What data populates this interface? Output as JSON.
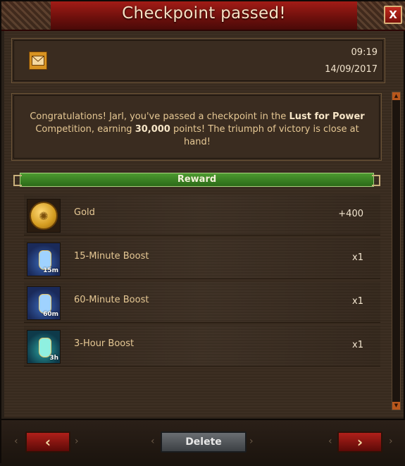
{
  "window": {
    "title": "Checkpoint passed!",
    "close_label": "X"
  },
  "message": {
    "time": "09:19",
    "date": "14/09/2017",
    "text_before": "Congratulations! Jarl, you've passed a checkpoint in the ",
    "competition": "Lust for Power",
    "text_mid": " Competition, earning ",
    "points": "30,000",
    "text_after": " points! The triumph of victory is close at hand!"
  },
  "reward": {
    "header": "Reward",
    "items": [
      {
        "name": "Gold",
        "qty": "+400",
        "icon": "gold-coin-icon"
      },
      {
        "name": "15-Minute Boost",
        "qty": "x1",
        "icon": "boost-potion-icon",
        "badge": "15m"
      },
      {
        "name": "60-Minute Boost",
        "qty": "x1",
        "icon": "boost-potion-icon",
        "badge": "60m"
      },
      {
        "name": "3-Hour Boost",
        "qty": "x1",
        "icon": "boost-potion-icon",
        "badge": "3h"
      }
    ]
  },
  "footer": {
    "prev_label": "‹",
    "delete_label": "Delete",
    "next_label": "›"
  },
  "colors": {
    "title_bar": "#a31c16",
    "reward_bar": "#3d8a26",
    "text_gold": "#e6c894"
  }
}
